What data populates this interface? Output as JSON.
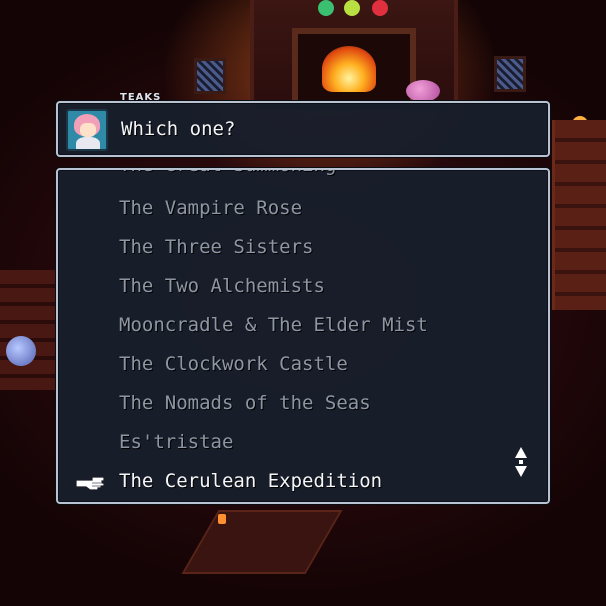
{
  "dialog": {
    "speaker": "TEAKS",
    "prompt": "Which one?"
  },
  "choices": [
    {
      "label": "The Great Summoning",
      "selected": false
    },
    {
      "label": "The Vampire Rose",
      "selected": false
    },
    {
      "label": "The Three Sisters",
      "selected": false
    },
    {
      "label": "The Two Alchemists",
      "selected": false
    },
    {
      "label": "Mooncradle & The Elder Mist",
      "selected": false
    },
    {
      "label": "The Clockwork Castle",
      "selected": false
    },
    {
      "label": "The Nomads of the Seas",
      "selected": false
    },
    {
      "label": "Es'tristae",
      "selected": false
    },
    {
      "label": "The Cerulean Expedition",
      "selected": true
    }
  ],
  "icons": {
    "cursor": "pointing-hand-icon",
    "scroll": "scroll-up-down-icon",
    "portrait": "teaks-portrait"
  },
  "colors": {
    "panel_bg": "#181e2c",
    "panel_border": "#b8c2d0",
    "text_selected": "#f4f6fa",
    "text_unselected": "#8e96a3"
  }
}
